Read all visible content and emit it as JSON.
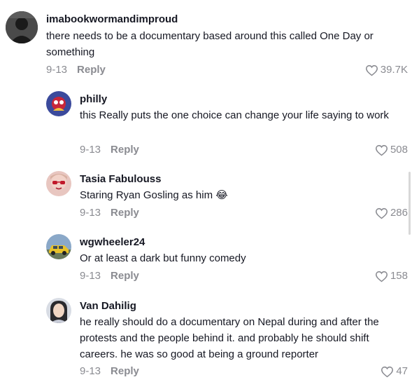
{
  "comments": [
    {
      "username": "imabookwormandimproud",
      "text": "there needs to be a documentary based around this called One Day or something",
      "date": "9-13",
      "reply_label": "Reply",
      "likes": "39.7K",
      "avatar": "dark-silhouette-avatar"
    },
    {
      "username": "philly",
      "text": "this Really puts the one choice can change your life saying to work",
      "date": "9-13",
      "reply_label": "Reply",
      "likes": "508",
      "avatar": "colorful-character-avatar"
    },
    {
      "username": "Tasia Fabulouss",
      "text": "Staring Ryan Gosling as him 😂",
      "date": "9-13",
      "reply_label": "Reply",
      "likes": "286",
      "avatar": "woman-red-sunglasses-avatar"
    },
    {
      "username": "wgwheeler24",
      "text": "Or at least a dark but funny comedy",
      "date": "9-13",
      "reply_label": "Reply",
      "likes": "158",
      "avatar": "yellow-car-avatar"
    },
    {
      "username": "Van Dahilig",
      "text": "he really should do a documentary on Nepal during and after the protests and the people behind it. and probably he should shift careers. he was so good at being a ground reporter",
      "date": "9-13",
      "reply_label": "Reply",
      "likes": "47",
      "avatar": "woman-portrait-avatar"
    }
  ],
  "icons": {
    "like": "heart-outline-icon"
  },
  "colors": {
    "text": "#161823",
    "meta": "#8a8b91",
    "background": "#ffffff"
  }
}
